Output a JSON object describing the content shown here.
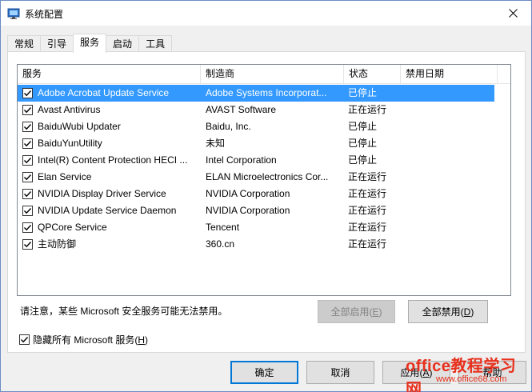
{
  "window": {
    "title": "系统配置"
  },
  "tabs": [
    {
      "label": "常规",
      "active": false
    },
    {
      "label": "引导",
      "active": false
    },
    {
      "label": "服务",
      "active": true
    },
    {
      "label": "启动",
      "active": false
    },
    {
      "label": "工具",
      "active": false
    }
  ],
  "services_table": {
    "headers": {
      "service": "服务",
      "manufacturer": "制造商",
      "status": "状态",
      "disabled_date": "禁用日期"
    },
    "rows": [
      {
        "checked": true,
        "name": "Adobe Acrobat Update Service",
        "manufacturer": "Adobe Systems Incorporat...",
        "status": "已停止",
        "disabled_date": "",
        "selected": true
      },
      {
        "checked": true,
        "name": "Avast Antivirus",
        "manufacturer": "AVAST Software",
        "status": "正在运行",
        "disabled_date": ""
      },
      {
        "checked": true,
        "name": "BaiduWubi Updater",
        "manufacturer": "Baidu, Inc.",
        "status": "已停止",
        "disabled_date": ""
      },
      {
        "checked": true,
        "name": "BaiduYunUtility",
        "manufacturer": "未知",
        "status": "已停止",
        "disabled_date": ""
      },
      {
        "checked": true,
        "name": "Intel(R) Content Protection HECI ...",
        "manufacturer": "Intel Corporation",
        "status": "已停止",
        "disabled_date": ""
      },
      {
        "checked": true,
        "name": "Elan Service",
        "manufacturer": "ELAN Microelectronics Cor...",
        "status": "正在运行",
        "disabled_date": ""
      },
      {
        "checked": true,
        "name": "NVIDIA Display Driver Service",
        "manufacturer": "NVIDIA Corporation",
        "status": "正在运行",
        "disabled_date": ""
      },
      {
        "checked": true,
        "name": "NVIDIA Update Service Daemon",
        "manufacturer": "NVIDIA Corporation",
        "status": "正在运行",
        "disabled_date": ""
      },
      {
        "checked": true,
        "name": "QPCore Service",
        "manufacturer": "Tencent",
        "status": "正在运行",
        "disabled_date": ""
      },
      {
        "checked": true,
        "name": "主动防御",
        "manufacturer": "360.cn",
        "status": "正在运行",
        "disabled_date": ""
      }
    ]
  },
  "notice": "请注意，某些 Microsoft 安全服务可能无法禁用。",
  "buttons": {
    "enable_all": {
      "label": "全部启用(",
      "key": "E",
      "suffix": ")"
    },
    "disable_all": {
      "label": "全部禁用(",
      "key": "D",
      "suffix": ")"
    },
    "ok": "确定",
    "cancel": "取消",
    "apply": {
      "label": "应用(",
      "key": "A",
      "suffix": ")"
    },
    "help": "帮助"
  },
  "hide_ms": {
    "checked": true,
    "label": "隐藏所有 Microsoft 服务(",
    "key": "H",
    "suffix": ")"
  },
  "watermark": {
    "line1": "office教程学习网",
    "line2": "www.office68.com"
  },
  "colors": {
    "selection": "#3399ff",
    "default_button_border": "#0078d7",
    "watermark": "#e8301c"
  }
}
